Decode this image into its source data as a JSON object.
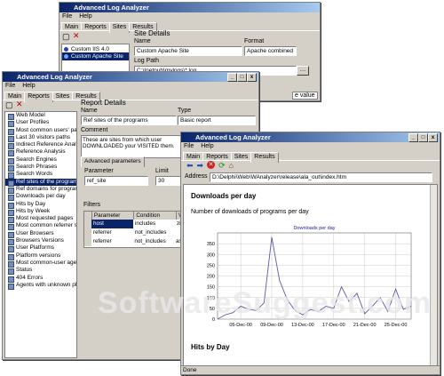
{
  "win1": {
    "title": "Advanced Log Analyzer",
    "menu": [
      "File",
      "Help"
    ],
    "tabs": [
      "Main",
      "Reports",
      "Sites",
      "Results"
    ],
    "site_list": [
      "Custom IIS 4.0",
      "Custom Apache Site"
    ],
    "section_title": "Site Details",
    "name_label": "Name",
    "name_value": "Custom Apache Site",
    "format_label": "Format",
    "format_value": "Apache combined",
    "logpath_label": "Log Path",
    "logpath_value": "C:\\Inetpub\\mylogs\\*.log",
    "value_col": "e value"
  },
  "win2": {
    "title": "Advanced Log Analyzer",
    "menu": [
      "File",
      "Help"
    ],
    "tabs": [
      "Main",
      "Reports",
      "Sites",
      "Results"
    ],
    "reports": [
      "Web Model",
      "User Profiles",
      "Most common users' paths",
      "Last 30 visitors paths",
      "Indirect Reference Anal...",
      "Reference Analysis",
      "Search Engines",
      "Search Phrases",
      "Search Words",
      "Ref sites of the programs",
      "Ref domains for programs",
      "Downloads per day",
      "Hits by Day",
      "Hits by Week",
      "Most requested pages",
      "Most common referrer sites",
      "User Browsers",
      "Browsers Versions",
      "User Platforms",
      "Platform versions",
      "Most common-user agents",
      "Status",
      "404 Errors",
      "Agents with unknown pla..."
    ],
    "selected_index": 9,
    "section_title": "Report Details",
    "name_label": "Name",
    "name_value": "Ref sites of the programs",
    "type_label": "Type",
    "type_value": "Basic report",
    "comment_label": "Comment",
    "comment_value": "These are sites from which user DOWNLOADED your VISITED them.",
    "adv_tab": "Advanced parameters",
    "param_label": "Parameter",
    "param_value": "ref_site",
    "limit_label": "Limit",
    "limit_value": "30",
    "filters_label": "Filters",
    "filter_cols": [
      "Parameter",
      "Condition",
      "Valu"
    ],
    "filters": [
      [
        "host",
        "includes",
        "zip"
      ],
      [
        "referrer",
        "not_includes",
        ""
      ],
      [
        "referrer",
        "not_includes",
        "aside"
      ]
    ]
  },
  "win3": {
    "title": "Advanced Log Analyzer",
    "menu": [
      "File",
      "Help"
    ],
    "tabs": [
      "Main",
      "Reports",
      "Sites",
      "Results"
    ],
    "address_label": "Address",
    "address_value": "D:\\Delphi\\Web\\WAnalyzer\\release\\ala_out\\index.htm",
    "heading1": "Downloads per day",
    "subtitle": "Number of downloads of programs per day",
    "heading2": "Hits by Day",
    "status": "Done"
  },
  "chart_data": {
    "type": "line",
    "title": "Downloads per day",
    "xlabel": "",
    "ylabel": "",
    "ylim": [
      0,
      400
    ],
    "yticks": [
      0,
      50,
      100,
      150,
      200,
      250,
      300,
      350
    ],
    "x_tick_labels": [
      "05-Dec-00",
      "09-Dec-00",
      "13-Dec-00",
      "17-Dec-00",
      "21-Dec-00",
      "25-Dec-00"
    ],
    "x_tick_positions": [
      3,
      7,
      11,
      15,
      19,
      23
    ],
    "series": [
      {
        "values": [
          0,
          20,
          30,
          60,
          45,
          40,
          75,
          380,
          180,
          90,
          40,
          20,
          45,
          35,
          60,
          50,
          150,
          80,
          120,
          25,
          60,
          100,
          35,
          140,
          45,
          60
        ]
      }
    ],
    "grid": true,
    "line_color": "#5a5aa8"
  },
  "watermark": "SoftwareSuggest.com"
}
